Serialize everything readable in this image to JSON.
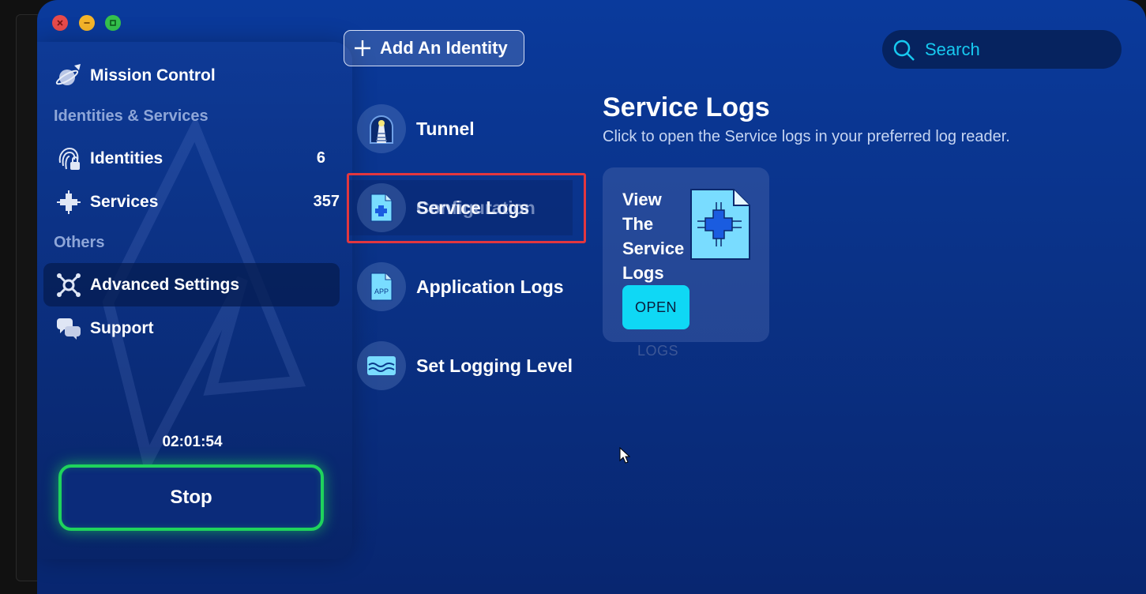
{
  "sidebar": {
    "mission_control": "Mission Control",
    "section_identities": "Identities & Services",
    "identities": {
      "label": "Identities",
      "count": "6"
    },
    "services": {
      "label": "Services",
      "count": "357"
    },
    "section_others": "Others",
    "advanced_settings": "Advanced Settings",
    "support": "Support",
    "timer": "02:01:54",
    "stop_label": "Stop"
  },
  "header": {
    "add_identity_label": "Add An Identity",
    "search_placeholder": "Search"
  },
  "menu": {
    "items": [
      {
        "label": "Tunnel",
        "icon": "tunnel-icon"
      },
      {
        "label": "Service Logs",
        "ghost_label": "Configuration",
        "icon": "service-logs-icon"
      },
      {
        "label": "Application Logs",
        "icon": "app-logs-icon",
        "icon_text": "APP"
      },
      {
        "label": "Set Logging Level",
        "icon": "logging-level-icon"
      }
    ]
  },
  "detail": {
    "title": "Service Logs",
    "description": "Click to open the Service logs in your preferred log reader.",
    "card_title": "View The Service Logs",
    "open_label": "OPEN",
    "ghost_label": "LOGS"
  },
  "colors": {
    "accent_cyan": "#0fd8f5",
    "stop_green": "#1fd35c",
    "selection_red": "#e2373f"
  }
}
